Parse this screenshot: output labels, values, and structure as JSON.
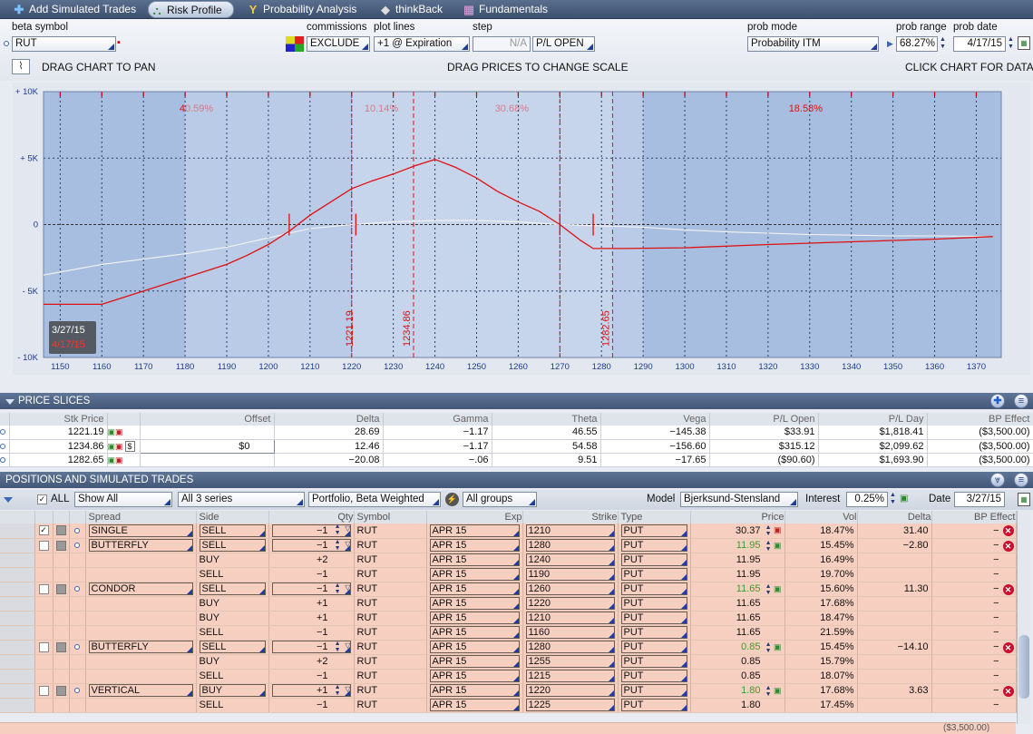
{
  "tabs": [
    {
      "label": "Add Simulated Trades",
      "icon": "plus-icon"
    },
    {
      "label": "Risk Profile",
      "icon": "risk-profile-icon",
      "active": true
    },
    {
      "label": "Probability Analysis",
      "icon": "probability-icon"
    },
    {
      "label": "thinkBack",
      "icon": "thinkback-icon"
    },
    {
      "label": "Fundamentals",
      "icon": "fundamentals-icon"
    }
  ],
  "controls": {
    "beta_symbol_label": "beta symbol",
    "beta_symbol_value": "RUT",
    "commissions_label": "commissions",
    "commissions_value": "EXCLUDE",
    "plot_lines_label": "plot lines",
    "plot_lines_value": "+1 @ Expiration",
    "step_label": "step",
    "step_value": "N/A",
    "pl_mode_value": "P/L OPEN",
    "prob_mode_label": "prob mode",
    "prob_mode_value": "Probability ITM",
    "prob_range_label": "prob range",
    "prob_range_value": "68.27%",
    "prob_date_label": "prob date",
    "prob_date_value": "4/17/15"
  },
  "chart_header": {
    "left": "DRAG CHART TO PAN",
    "center": "DRAG PRICES TO CHANGE SCALE",
    "right": "CLICK CHART FOR DATA"
  },
  "chart_data": {
    "type": "line",
    "xlim": [
      1146,
      1376
    ],
    "ylim": [
      -10000,
      10000
    ],
    "x_ticks": [
      1150,
      1160,
      1170,
      1180,
      1190,
      1200,
      1210,
      1220,
      1230,
      1240,
      1250,
      1260,
      1270,
      1280,
      1290,
      1300,
      1310,
      1320,
      1330,
      1340,
      1350,
      1360,
      1370
    ],
    "y_ticks": [
      {
        "v": 10000,
        "l": "+ 10K"
      },
      {
        "v": 5000,
        "l": "+ 5K"
      },
      {
        "v": 0,
        "l": "0"
      },
      {
        "v": -5000,
        "l": "- 5K"
      },
      {
        "v": -10000,
        "l": "- 10K"
      }
    ],
    "series": [
      {
        "name": "4/17/15",
        "color": "#e01010",
        "points": [
          [
            1146,
            -6000
          ],
          [
            1160,
            -6000
          ],
          [
            1165,
            -5500
          ],
          [
            1170,
            -5000
          ],
          [
            1180,
            -4000
          ],
          [
            1190,
            -3000
          ],
          [
            1195,
            -2300
          ],
          [
            1200,
            -1500
          ],
          [
            1205,
            -500
          ],
          [
            1210,
            700
          ],
          [
            1215,
            1700
          ],
          [
            1220,
            2700
          ],
          [
            1225,
            3300
          ],
          [
            1230,
            3800
          ],
          [
            1235,
            4400
          ],
          [
            1240,
            4900
          ],
          [
            1245,
            4300
          ],
          [
            1250,
            3500
          ],
          [
            1255,
            2500
          ],
          [
            1260,
            1700
          ],
          [
            1265,
            1000
          ],
          [
            1270,
            0
          ],
          [
            1275,
            -1200
          ],
          [
            1278,
            -1800
          ],
          [
            1285,
            -1800
          ],
          [
            1300,
            -1750
          ],
          [
            1320,
            -1500
          ],
          [
            1340,
            -1300
          ],
          [
            1360,
            -1100
          ],
          [
            1374,
            -900
          ]
        ]
      },
      {
        "name": "3/27/15",
        "color": "#f4f4f4",
        "points": [
          [
            1146,
            -3800
          ],
          [
            1160,
            -3000
          ],
          [
            1170,
            -2600
          ],
          [
            1180,
            -2200
          ],
          [
            1190,
            -1700
          ],
          [
            1200,
            -1000
          ],
          [
            1210,
            -300
          ],
          [
            1220,
            0
          ],
          [
            1230,
            200
          ],
          [
            1240,
            300
          ],
          [
            1250,
            300
          ],
          [
            1260,
            200
          ],
          [
            1270,
            0
          ],
          [
            1280,
            -100
          ],
          [
            1290,
            -200
          ],
          [
            1300,
            -400
          ],
          [
            1310,
            -550
          ],
          [
            1320,
            -650
          ],
          [
            1330,
            -750
          ],
          [
            1340,
            -800
          ],
          [
            1350,
            -850
          ],
          [
            1360,
            -850
          ],
          [
            1374,
            -900
          ]
        ]
      }
    ],
    "price_lines": [
      1221.19,
      1234.86,
      1282.65
    ],
    "prob_lines": [
      1220,
      1234.86,
      1270,
      1282.65
    ],
    "prob_regions": [
      {
        "from": 1146,
        "to": 1220,
        "label": "40.59%"
      },
      {
        "from": 1220,
        "to": 1234.86,
        "label": "10.14%"
      },
      {
        "from": 1234.86,
        "to": 1282.65,
        "label": "30.68%"
      },
      {
        "from": 1282.65,
        "to": 1376,
        "label": "18.58%"
      }
    ],
    "breakeven_marks": [
      1205,
      1221,
      1270,
      1278
    ],
    "legend": [
      "3/27/15",
      "4/17/15"
    ]
  },
  "price_slices": {
    "title": "PRICE SLICES",
    "columns": [
      "Stk Price",
      "Offset",
      "Delta",
      "Gamma",
      "Theta",
      "Vega",
      "P/L Open",
      "P/L Day",
      "BP Effect"
    ],
    "rows": [
      {
        "price": "1221.19",
        "offset": "",
        "delta": "28.69",
        "gamma": "−1.17",
        "theta": "46.55",
        "vega": "−145.38",
        "pl_open": "$33.91",
        "pl_day": "$1,818.41",
        "bp": "($3,500.00)"
      },
      {
        "price": "1234.86",
        "offset": "$0",
        "delta": "12.46",
        "gamma": "−1.17",
        "theta": "54.58",
        "vega": "−156.60",
        "pl_open": "$315.12",
        "pl_day": "$2,099.62",
        "bp": "($3,500.00)"
      },
      {
        "price": "1282.65",
        "offset": "",
        "delta": "−20.08",
        "gamma": "−.06",
        "theta": "9.51",
        "vega": "−17.65",
        "pl_open": "($90.60)",
        "pl_day": "$1,693.90",
        "bp": "($3,500.00)"
      }
    ]
  },
  "positions": {
    "title": "POSITIONS AND SIMULATED TRADES",
    "all_label": "ALL",
    "show_value": "Show All",
    "series_value": "All 3 series",
    "portfolio_value": "Portfolio, Beta Weighted",
    "groups_value": "All groups",
    "model_label": "Model",
    "model_value": "Bjerksund-Stensland",
    "interest_label": "Interest",
    "interest_value": "0.25%",
    "date_label": "Date",
    "date_value": "3/27/15",
    "columns": [
      "Spread",
      "Side",
      "Qty",
      "Symbol",
      "Exp",
      "Strike",
      "Type",
      "Price",
      "Vol",
      "Delta",
      "BP Effect"
    ],
    "rows": [
      {
        "spread": "SINGLE",
        "side": "SELL",
        "qty": "−1",
        "symbol": "RUT",
        "exp": "APR 15",
        "strike": "1210",
        "type": "PUT",
        "price": "30.37",
        "price_green": false,
        "vol": "18.47%",
        "delta": "31.40",
        "bp": "−",
        "head": true,
        "checked": true
      },
      {
        "spread": "BUTTERFLY",
        "side": "SELL",
        "qty": "−1",
        "symbol": "RUT",
        "exp": "APR 15",
        "strike": "1280",
        "type": "PUT",
        "price": "11.95",
        "price_green": true,
        "vol": "15.45%",
        "delta": "−2.80",
        "bp": "−",
        "head": true
      },
      {
        "spread": "",
        "side": "BUY",
        "qty": "+2",
        "symbol": "RUT",
        "exp": "APR 15",
        "strike": "1240",
        "type": "PUT",
        "price": "11.95",
        "vol": "16.49%",
        "delta": "",
        "bp": "−"
      },
      {
        "spread": "",
        "side": "SELL",
        "qty": "−1",
        "symbol": "RUT",
        "exp": "APR 15",
        "strike": "1190",
        "type": "PUT",
        "price": "11.95",
        "vol": "19.70%",
        "delta": "",
        "bp": "−"
      },
      {
        "spread": "CONDOR",
        "side": "SELL",
        "qty": "−1",
        "symbol": "RUT",
        "exp": "APR 15",
        "strike": "1260",
        "type": "PUT",
        "price": "11.65",
        "price_green": true,
        "vol": "15.60%",
        "delta": "11.30",
        "bp": "−",
        "head": true
      },
      {
        "spread": "",
        "side": "BUY",
        "qty": "+1",
        "symbol": "RUT",
        "exp": "APR 15",
        "strike": "1220",
        "type": "PUT",
        "price": "11.65",
        "vol": "17.68%",
        "delta": "",
        "bp": "−"
      },
      {
        "spread": "",
        "side": "BUY",
        "qty": "+1",
        "symbol": "RUT",
        "exp": "APR 15",
        "strike": "1210",
        "type": "PUT",
        "price": "11.65",
        "vol": "18.47%",
        "delta": "",
        "bp": "−"
      },
      {
        "spread": "",
        "side": "SELL",
        "qty": "−1",
        "symbol": "RUT",
        "exp": "APR 15",
        "strike": "1160",
        "type": "PUT",
        "price": "11.65",
        "vol": "21.59%",
        "delta": "",
        "bp": "−"
      },
      {
        "spread": "BUTTERFLY",
        "side": "SELL",
        "qty": "−1",
        "symbol": "RUT",
        "exp": "APR 15",
        "strike": "1280",
        "type": "PUT",
        "price": "0.85",
        "price_green": true,
        "vol": "15.45%",
        "delta": "−14.10",
        "bp": "−",
        "head": true
      },
      {
        "spread": "",
        "side": "BUY",
        "qty": "+2",
        "symbol": "RUT",
        "exp": "APR 15",
        "strike": "1255",
        "type": "PUT",
        "price": "0.85",
        "vol": "15.79%",
        "delta": "",
        "bp": "−"
      },
      {
        "spread": "",
        "side": "SELL",
        "qty": "−1",
        "symbol": "RUT",
        "exp": "APR 15",
        "strike": "1215",
        "type": "PUT",
        "price": "0.85",
        "vol": "18.07%",
        "delta": "",
        "bp": "−"
      },
      {
        "spread": "VERTICAL",
        "side": "BUY",
        "qty": "+1",
        "symbol": "RUT",
        "exp": "APR 15",
        "strike": "1220",
        "type": "PUT",
        "price": "1.80",
        "price_green": true,
        "vol": "17.68%",
        "delta": "3.63",
        "bp": "−",
        "head": true
      },
      {
        "spread": "",
        "side": "SELL",
        "qty": "−1",
        "symbol": "RUT",
        "exp": "APR 15",
        "strike": "1225",
        "type": "PUT",
        "price": "1.80",
        "vol": "17.45%",
        "delta": "",
        "bp": "−"
      }
    ],
    "total_bp": "($3,500.00)"
  }
}
